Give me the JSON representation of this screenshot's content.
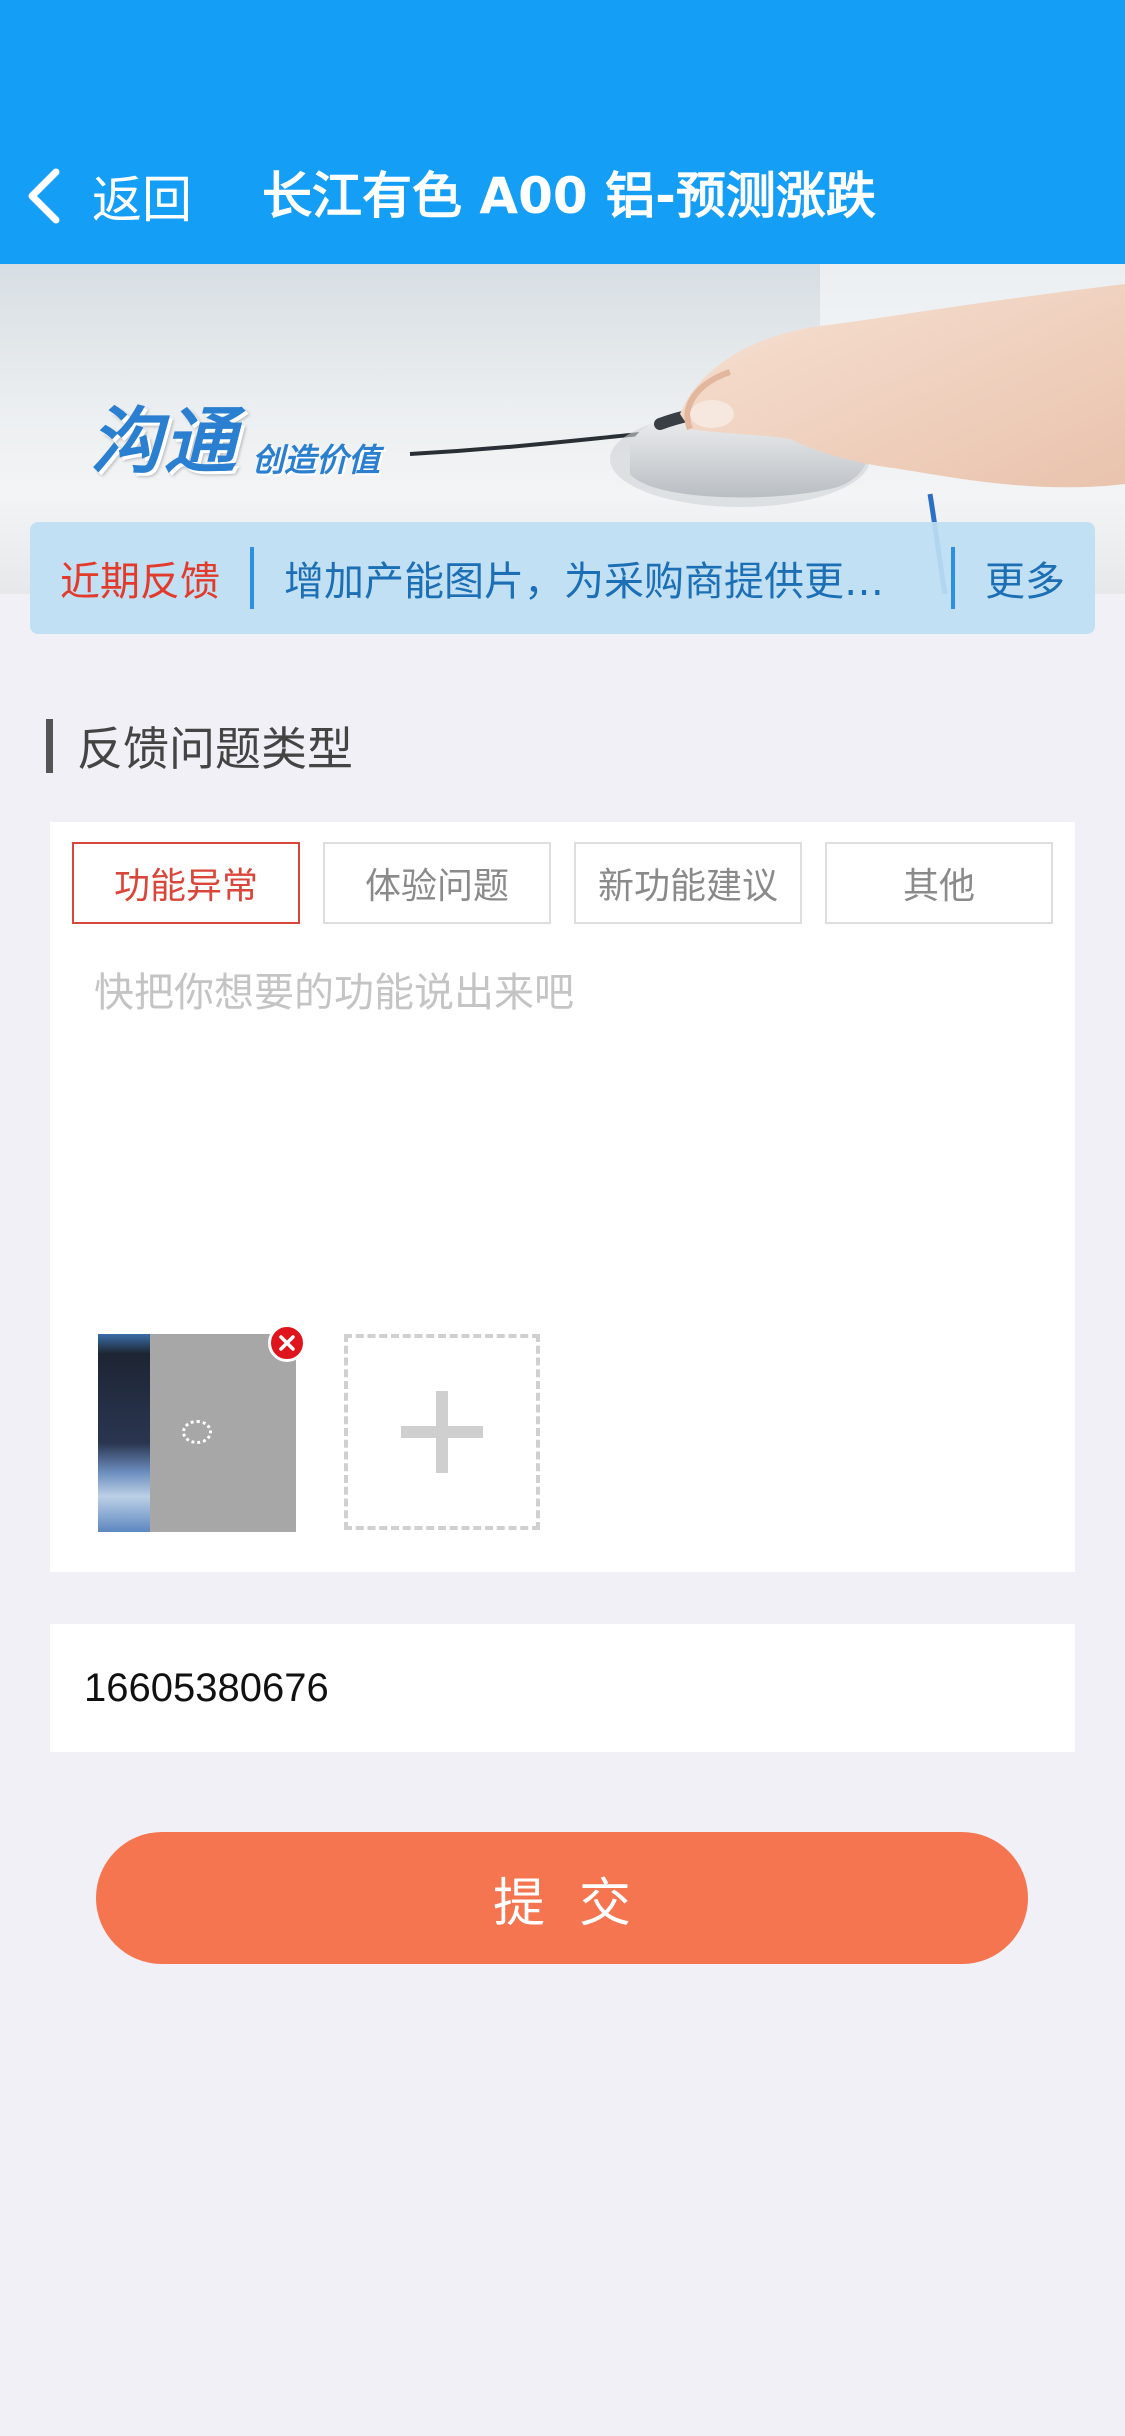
{
  "header": {
    "back_label": "返回",
    "title": "长江有色 A00 铝-预测涨跌"
  },
  "banner": {
    "logo_main": "沟通",
    "logo_sub": "创造价值"
  },
  "recent_feedback": {
    "label": "近期反馈",
    "text": "增加产能图片，为采购商提供更…",
    "more_label": "更多"
  },
  "feedback": {
    "section_title": "反馈问题类型",
    "types": [
      "功能异常",
      "体验问题",
      "新功能建议",
      "其他"
    ],
    "selected_type": "功能异常",
    "placeholder": "快把你想要的功能说出来吧"
  },
  "contact": {
    "phone_value": "16605380676"
  },
  "submit_label": "提交",
  "colors": {
    "header_bg": "#159ef5",
    "accent_red": "#d9463a",
    "submit_bg": "#f47550",
    "page_bg": "#f0f0f6"
  }
}
